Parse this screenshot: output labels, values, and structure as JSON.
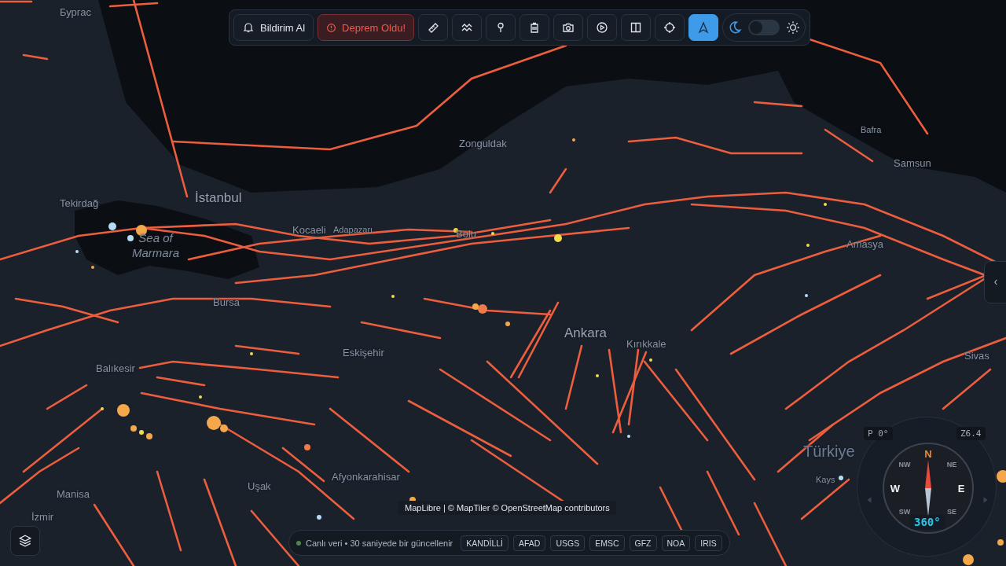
{
  "toolbar": {
    "notify_button": "Bildirim Al",
    "alert_button": "Deprem Oldu!",
    "tools": [
      {
        "kind": "ruler",
        "selected": false
      },
      {
        "kind": "wave",
        "selected": false
      },
      {
        "kind": "pin",
        "selected": false
      },
      {
        "kind": "trash",
        "selected": false
      },
      {
        "kind": "camera",
        "selected": false
      },
      {
        "kind": "play",
        "selected": false
      },
      {
        "kind": "split",
        "selected": false
      },
      {
        "kind": "crosshair",
        "selected": false
      },
      {
        "kind": "navigate",
        "selected": true
      }
    ],
    "theme_toggle": {
      "on": false
    }
  },
  "map": {
    "labels": [
      {
        "text": "Бургас",
        "kind": "city"
      },
      {
        "text": "İstanbul",
        "kind": "major"
      },
      {
        "text": "Tekirdağ",
        "kind": "city"
      },
      {
        "text": "Sea of Marmara",
        "kind": "water"
      },
      {
        "text": "Kocaeli",
        "kind": "city"
      },
      {
        "text": "Adapazarı",
        "kind": "small"
      },
      {
        "text": "Bolu",
        "kind": "city"
      },
      {
        "text": "Zonguldak",
        "kind": "city"
      },
      {
        "text": "Bafra",
        "kind": "small"
      },
      {
        "text": "Samsun",
        "kind": "city"
      },
      {
        "text": "Amasya",
        "kind": "city"
      },
      {
        "text": "Bursa",
        "kind": "city"
      },
      {
        "text": "Ankara",
        "kind": "major"
      },
      {
        "text": "Kırıkkale",
        "kind": "city"
      },
      {
        "text": "Balıkesir",
        "kind": "city"
      },
      {
        "text": "Eskişehir",
        "kind": "city"
      },
      {
        "text": "Sivas",
        "kind": "city"
      },
      {
        "text": "Türkiye",
        "kind": "country"
      },
      {
        "text": "Kays",
        "kind": "small"
      },
      {
        "text": "Uşak",
        "kind": "city"
      },
      {
        "text": "Afyonkarahisar",
        "kind": "city"
      },
      {
        "text": "Manisa",
        "kind": "city"
      },
      {
        "text": "İzmir",
        "kind": "city"
      }
    ],
    "attribution": "MapLibre | © MapTiler © OpenStreetMap contributors"
  },
  "compass": {
    "pitch": "P 0°",
    "zoom": "Z6.4",
    "heading": "360°",
    "directions": [
      "N",
      "NE",
      "E",
      "SE",
      "SW",
      "W",
      "NW"
    ]
  },
  "status_bar": {
    "live": true,
    "text": "Canlı veri • 30 saniyede bir güncellenir",
    "sources": [
      "KANDİLLİ",
      "AFAD",
      "USGS",
      "EMSC",
      "GFZ",
      "NOA",
      "IRIS"
    ]
  }
}
